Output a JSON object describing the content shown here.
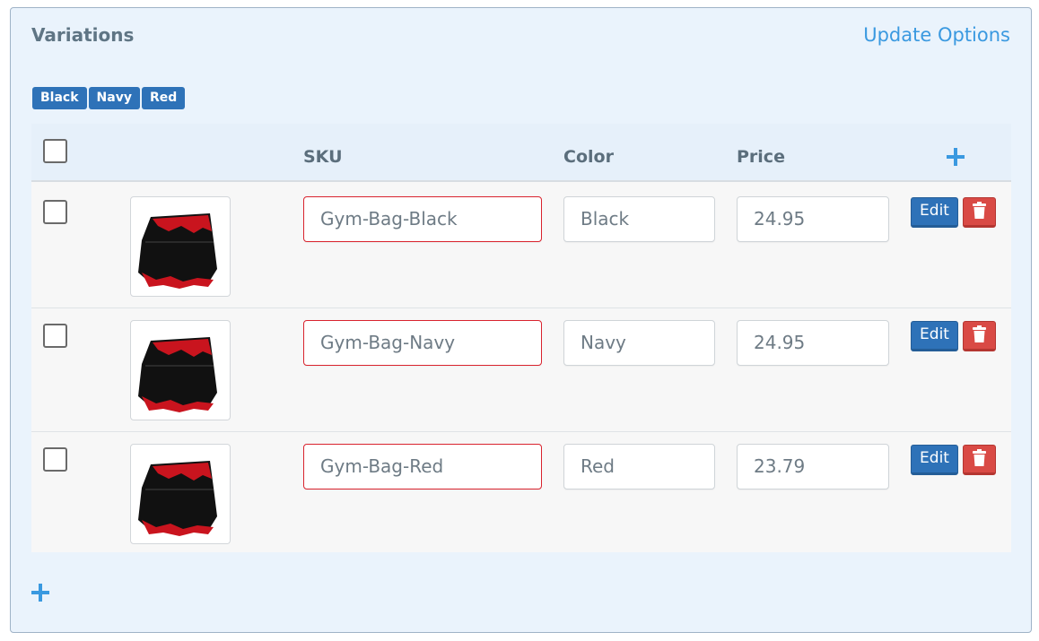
{
  "panel": {
    "title": "Variations",
    "update_link": "Update Options"
  },
  "tags": [
    "Black",
    "Navy",
    "Red"
  ],
  "table": {
    "headers": {
      "sku": "SKU",
      "color": "Color",
      "price": "Price"
    },
    "rows": [
      {
        "sku": "Gym-Bag-Black",
        "color": "Black",
        "price": "24.95",
        "edit": "Edit"
      },
      {
        "sku": "Gym-Bag-Navy",
        "color": "Navy",
        "price": "24.95",
        "edit": "Edit"
      },
      {
        "sku": "Gym-Bag-Red",
        "color": "Red",
        "price": "23.79",
        "edit": "Edit"
      }
    ]
  },
  "icons": {
    "add_column": "plus-icon",
    "add_row": "plus-icon",
    "delete": "trash-icon",
    "product_thumbnail": "gym-bag-image"
  },
  "colors": {
    "accent": "#3a99e0",
    "tag": "#2e72b8",
    "edit_button": "#2e72b8",
    "delete_button": "#d94a45",
    "invalid_border": "#d9232e"
  }
}
